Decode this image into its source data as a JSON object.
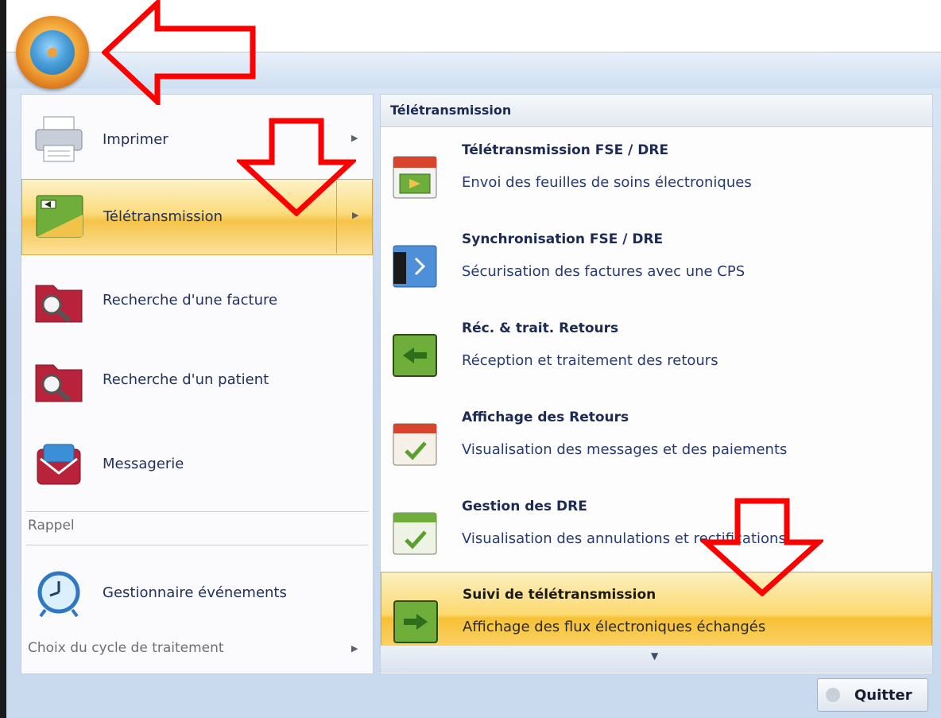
{
  "left_menu": {
    "items": [
      {
        "label": "Imprimer",
        "icon": "printer-icon",
        "has_submenu": true
      },
      {
        "label": "Télétransmission",
        "icon": "teletransmission-icon",
        "has_submenu": true,
        "selected": true
      },
      {
        "label": "Recherche d'une facture",
        "icon": "search-invoice-icon"
      },
      {
        "label": "Recherche d'un patient",
        "icon": "search-patient-icon"
      },
      {
        "label": "Messagerie",
        "icon": "messaging-icon"
      }
    ],
    "section_rappel": "Rappel",
    "rappel_item": {
      "label": "Gestionnaire événements",
      "icon": "alarm-clock-icon"
    },
    "cycle_label": "Choix du cycle de traitement"
  },
  "submenu": {
    "header": "Télétransmission",
    "items": [
      {
        "title": "Télétransmission FSE / DRE",
        "desc": "Envoi des feuilles de soins  électroniques",
        "icon": "send-fse-icon"
      },
      {
        "title": "Synchronisation FSE / DRE",
        "desc": "Sécurisation des factures avec une CPS",
        "icon": "sync-icon"
      },
      {
        "title": "Réc. & trait. Retours",
        "desc": "Réception et traitement des retours",
        "icon": "receive-icon"
      },
      {
        "title": "Affichage des Retours",
        "desc": "Visualisation des messages et des paiements",
        "icon": "display-returns-icon"
      },
      {
        "title": "Gestion des DRE",
        "desc": "Visualisation des annulations et rectifications",
        "icon": "manage-dre-icon"
      },
      {
        "title": "Suivi de télétransmission",
        "desc": "Affichage des flux électroniques échangés",
        "icon": "tracking-icon",
        "selected": true
      }
    ]
  },
  "footer": {
    "quit_label": "Quitter"
  },
  "colors": {
    "highlight": "#f7c138",
    "annotation_arrow": "#ff0000",
    "text_blue": "#1c2a55"
  }
}
